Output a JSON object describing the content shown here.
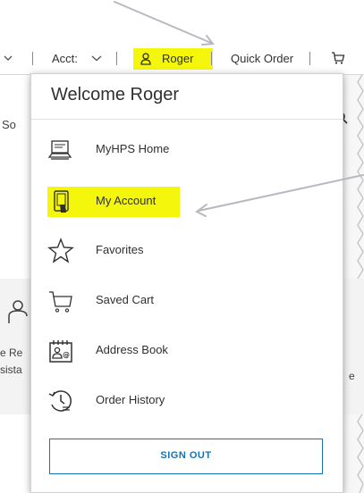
{
  "topbar": {
    "acct_label": "Acct:",
    "user_name": "Roger",
    "quick_order": "Quick Order"
  },
  "background": {
    "search_fragment": "So",
    "text_fragment_1": "e Re",
    "text_fragment_2": "sista",
    "text_fragment_3": "e"
  },
  "dropdown": {
    "title": "Welcome Roger",
    "items": [
      {
        "label": "MyHPS Home",
        "icon": "laptop-icon"
      },
      {
        "label": "My Account",
        "icon": "account-tablet-icon"
      },
      {
        "label": "Favorites",
        "icon": "star-icon"
      },
      {
        "label": "Saved Cart",
        "icon": "cart-icon"
      },
      {
        "label": "Address Book",
        "icon": "address-book-icon"
      },
      {
        "label": "Order History",
        "icon": "history-icon"
      }
    ],
    "sign_out": "SIGN OUT"
  },
  "colors": {
    "highlight": "#f4f60c",
    "accent": "#1473b4",
    "arrow": "#b8b8c0"
  }
}
